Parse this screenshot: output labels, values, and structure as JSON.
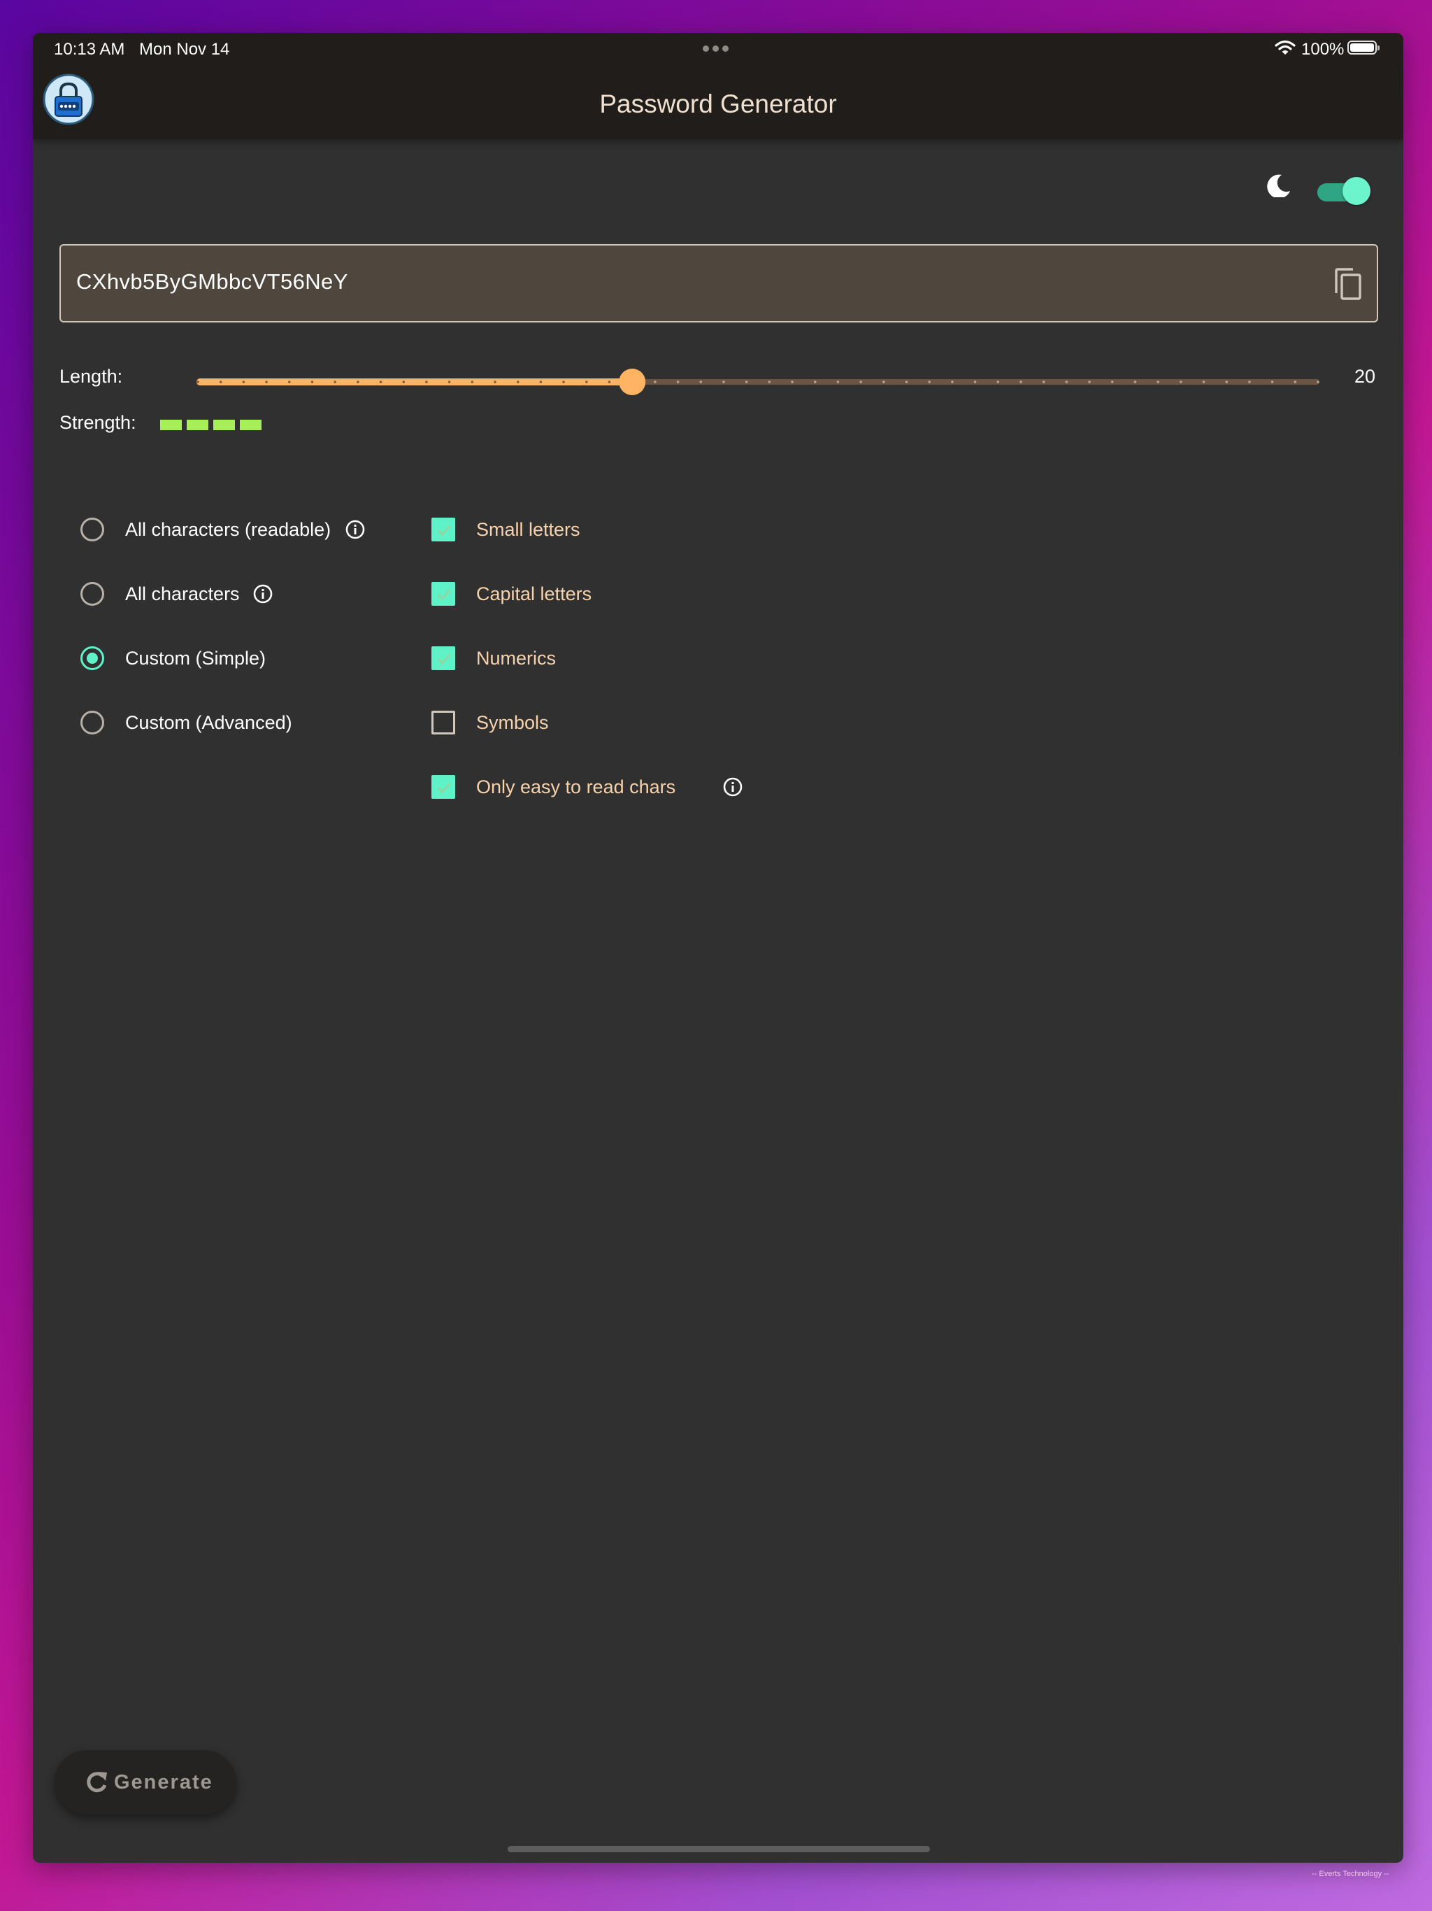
{
  "status_bar": {
    "time": "10:13 AM",
    "date": "Mon Nov 14",
    "battery": "100%"
  },
  "app": {
    "title": "Password Generator",
    "logo_icon": "padlock-logo-icon"
  },
  "theme": {
    "dark_mode_on": true,
    "moon_icon": "moon-icon"
  },
  "password": {
    "value": "CXhvb5ByGMbbcVT56NeY",
    "copy_icon": "copy-icon"
  },
  "length": {
    "label": "Length:",
    "value": "20",
    "min": 1,
    "max": 50,
    "current": 20
  },
  "strength": {
    "label": "Strength:",
    "filled_segments": 4,
    "color": "#a6ef56"
  },
  "modes": [
    {
      "label": "All characters (readable)",
      "selected": false,
      "has_info": true
    },
    {
      "label": "All characters",
      "selected": false,
      "has_info": true
    },
    {
      "label": "Custom (Simple)",
      "selected": true,
      "has_info": false
    },
    {
      "label": "Custom (Advanced)",
      "selected": false,
      "has_info": false
    }
  ],
  "options": [
    {
      "label": "Small letters",
      "checked": true,
      "has_info": false
    },
    {
      "label": "Capital letters",
      "checked": true,
      "has_info": false
    },
    {
      "label": "Numerics",
      "checked": true,
      "has_info": false
    },
    {
      "label": "Symbols",
      "checked": false,
      "has_info": false
    },
    {
      "label": "Only easy to read chars",
      "checked": true,
      "has_info": true
    }
  ],
  "generate_button": {
    "label": "Generate",
    "icon": "refresh-icon"
  },
  "watermark": "-- Everts Technology --",
  "colors": {
    "accent": "#5ff2c8",
    "slider": "#ffb463",
    "header_bg": "#201d1a",
    "body_bg": "#303030"
  }
}
